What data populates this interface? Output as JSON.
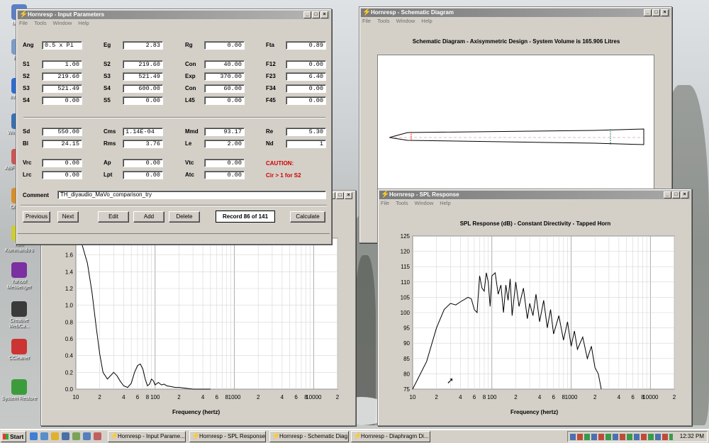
{
  "desktop": {
    "icons": [
      {
        "label": "My Co",
        "color": "#5a7fc4"
      },
      {
        "label": "Recy",
        "color": "#7b9bc8"
      },
      {
        "label": "Inte Exp",
        "color": "#2d6bd2"
      },
      {
        "label": "Win Media",
        "color": "#3a6fb0"
      },
      {
        "label": "ABF C Expre",
        "color": "#c55"
      },
      {
        "label": "Offi Exp",
        "color": "#d88d2a"
      },
      {
        "label": "Kim Kommando's",
        "color": "#cc3"
      },
      {
        "label": "Yahoo! Messenger",
        "color": "#7b2fa0"
      },
      {
        "label": "Creative WebCa...",
        "color": "#3a3a3a"
      },
      {
        "label": "CCleaner",
        "color": "#c33"
      },
      {
        "label": "System Restore",
        "color": "#3c9c3c"
      }
    ]
  },
  "input_window": {
    "title": "Hornresp - Input Parameters",
    "menu": [
      "File",
      "Tools",
      "Window",
      "Help"
    ],
    "rows1": [
      [
        {
          "l": "Ang",
          "v": "0.5 x Pi",
          "left": true
        },
        {
          "l": "Eg",
          "v": "2.83"
        },
        {
          "l": "Rg",
          "v": "0.00"
        },
        {
          "l": "Fta",
          "v": "0.89"
        }
      ],
      [
        {
          "l": "S1",
          "v": "1.00"
        },
        {
          "l": "S2",
          "v": "219.60"
        },
        {
          "l": "Con",
          "v": "40.00"
        },
        {
          "l": "F12",
          "v": "0.00"
        }
      ],
      [
        {
          "l": "S2",
          "v": "219.60"
        },
        {
          "l": "S3",
          "v": "521.49"
        },
        {
          "l": "Exp",
          "v": "370.00"
        },
        {
          "l": "F23",
          "v": "6.40"
        }
      ],
      [
        {
          "l": "S3",
          "v": "521.49"
        },
        {
          "l": "S4",
          "v": "600.00"
        },
        {
          "l": "Con",
          "v": "60.00"
        },
        {
          "l": "F34",
          "v": "0.00"
        }
      ],
      [
        {
          "l": "S4",
          "v": "0.00"
        },
        {
          "l": "S5",
          "v": "0.00"
        },
        {
          "l": "L45",
          "v": "0.00"
        },
        {
          "l": "F45",
          "v": "0.00"
        }
      ]
    ],
    "rows2": [
      [
        {
          "l": "Sd",
          "v": "550.00"
        },
        {
          "l": "Cms",
          "v": "1.14E-04",
          "left": true
        },
        {
          "l": "Mmd",
          "v": "93.17"
        },
        {
          "l": "Re",
          "v": "5.30"
        }
      ],
      [
        {
          "l": "Bl",
          "v": "24.15"
        },
        {
          "l": "Rms",
          "v": "3.76"
        },
        {
          "l": "Le",
          "v": "2.00"
        },
        {
          "l": "Nd",
          "v": "1"
        }
      ]
    ],
    "rows3": [
      [
        {
          "l": "Vrc",
          "v": "0.00"
        },
        {
          "l": "Ap",
          "v": "0.00"
        },
        {
          "l": "Vtc",
          "v": "0.00"
        }
      ],
      [
        {
          "l": "Lrc",
          "v": "0.00"
        },
        {
          "l": "Lpt",
          "v": "0.00"
        },
        {
          "l": "Atc",
          "v": "0.00"
        }
      ]
    ],
    "caution": "CAUTION:",
    "caution_msg": "Cir > 1 for S2",
    "comment_label": "Comment",
    "comment": "TH_diyaudio_MaVo_comparison_try",
    "buttons": [
      "Previous",
      "Next",
      "Edit",
      "Add",
      "Delete"
    ],
    "record": "Record 86 of 141",
    "calculate": "Calculate"
  },
  "schematic_window": {
    "title": "Hornresp - Schematic Diagram",
    "menu": [
      "File",
      "Tools",
      "Window",
      "Help"
    ],
    "heading": "Schematic Diagram - Axisymmetric Design - System Volume is 165.906 Litres"
  },
  "spl_window": {
    "title": "Hornresp - SPL Response",
    "menu": [
      "File",
      "Tools",
      "Window",
      "Help"
    ],
    "chart_title": "SPL Response (dB) - Constant Directivity - Tapped Horn",
    "xlabel": "Frequency (hertz)"
  },
  "diaphragm_window": {
    "xlabel": "Frequency (hertz)"
  },
  "x_ticks": [
    "10",
    "2",
    "4",
    "6",
    "8",
    "100",
    "2",
    "4",
    "6",
    "8",
    "1000",
    "2",
    "4",
    "6",
    "8",
    "10000",
    "2"
  ],
  "chart_data": [
    {
      "type": "line",
      "title": "SPL Response (dB) - Constant Directivity - Tapped Horn",
      "xlabel": "Frequency (hertz)",
      "ylabel": "",
      "xscale": "log",
      "xlim": [
        10,
        20000
      ],
      "ylim": [
        75,
        125
      ],
      "yticks": [
        75,
        80,
        85,
        90,
        95,
        100,
        105,
        110,
        115,
        120,
        125
      ],
      "grid": true,
      "series": [
        {
          "x": [
            10,
            15,
            20,
            25,
            30,
            35,
            40,
            50,
            55,
            60,
            65,
            70,
            75,
            80,
            85,
            90,
            95,
            100,
            110,
            120,
            130,
            140,
            150,
            160,
            170,
            180,
            200,
            220,
            250,
            280,
            300,
            330,
            360,
            400,
            450,
            500,
            550,
            600,
            700,
            800,
            900,
            1000,
            1100,
            1200,
            1400,
            1600,
            1800,
            2000,
            2200,
            2400
          ],
          "y": [
            75,
            84,
            95,
            101,
            103,
            102.5,
            103.5,
            105,
            104.5,
            101,
            100,
            112,
            108,
            107,
            113,
            110,
            102,
            112,
            113,
            106,
            109,
            100,
            109,
            104,
            111,
            99,
            110,
            102,
            108,
            98,
            103,
            99,
            106,
            97,
            104,
            95,
            101,
            93,
            99,
            91,
            97,
            89,
            94,
            88,
            92,
            85,
            89,
            82,
            80,
            75
          ]
        }
      ]
    },
    {
      "type": "line",
      "title": "",
      "xlabel": "Frequency (hertz)",
      "ylabel": "",
      "xscale": "log",
      "xlim": [
        10,
        20000
      ],
      "ylim": [
        0.0,
        1.8
      ],
      "yticks": [
        0.0,
        0.2,
        0.4,
        0.6,
        0.8,
        1.0,
        1.2,
        1.4,
        1.6,
        1.8
      ],
      "grid": true,
      "series": [
        {
          "x": [
            10,
            12,
            14,
            16,
            18,
            20,
            22,
            25,
            28,
            30,
            33,
            36,
            40,
            45,
            50,
            55,
            60,
            65,
            70,
            75,
            80,
            85,
            90,
            95,
            100,
            110,
            120,
            130,
            140,
            160,
            180,
            200,
            250,
            300,
            400,
            500
          ],
          "y": [
            1.85,
            1.72,
            1.5,
            1.15,
            0.75,
            0.42,
            0.2,
            0.12,
            0.17,
            0.2,
            0.16,
            0.1,
            0.04,
            0.02,
            0.07,
            0.2,
            0.28,
            0.3,
            0.24,
            0.12,
            0.04,
            0.06,
            0.12,
            0.1,
            0.05,
            0.08,
            0.05,
            0.06,
            0.04,
            0.03,
            0.02,
            0.02,
            0.01,
            0.0,
            0.0,
            0.0
          ]
        }
      ]
    }
  ],
  "taskbar": {
    "start": "Start",
    "tasks": [
      "Hornresp - Input Parame...",
      "Hornresp - SPL Response",
      "Hornresp - Schematic Diag...",
      "Hornresp - Diaphragm Di..."
    ],
    "clock": "12:32 PM"
  }
}
